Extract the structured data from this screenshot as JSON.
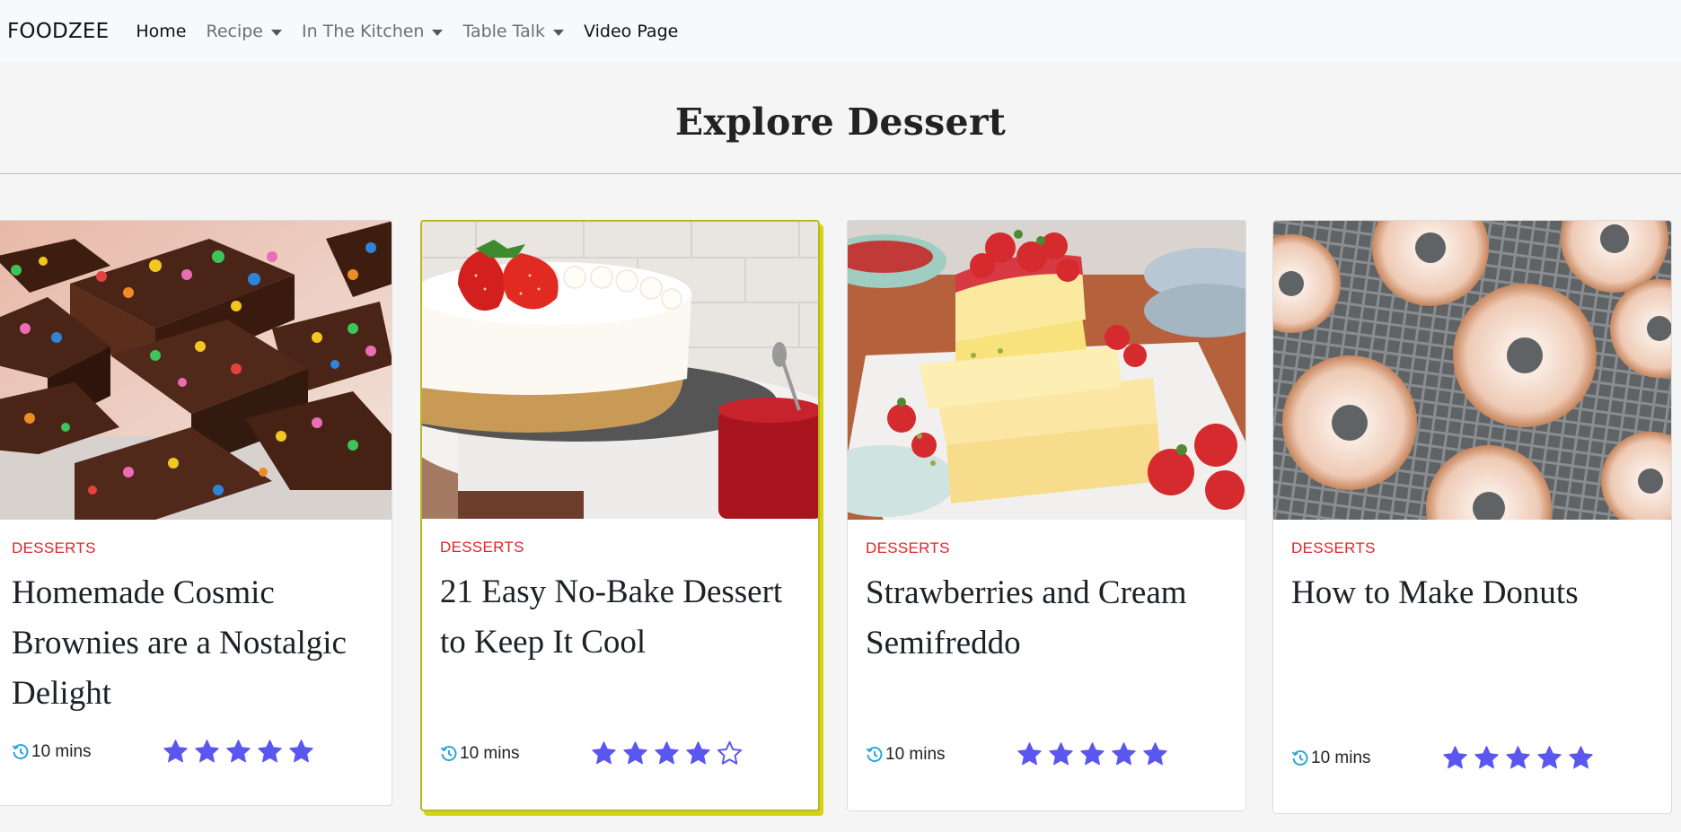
{
  "navbar": {
    "brand": "FOODZEE",
    "links": [
      {
        "label": "Home",
        "dropdown": false
      },
      {
        "label": "Recipe",
        "dropdown": true
      },
      {
        "label": "In The Kitchen",
        "dropdown": true
      },
      {
        "label": "Table Talk",
        "dropdown": true
      },
      {
        "label": "Video Page",
        "dropdown": false
      }
    ]
  },
  "page": {
    "title": "Explore Dessert"
  },
  "colors": {
    "category": "#e0262a",
    "star": "#5a56f0",
    "clock": "#2aa8d8",
    "highlight_border": "#d4d415"
  },
  "cards": [
    {
      "category": "DESSERTS",
      "title": "Homemade Cosmic Brownies are a Nostalgic Delight",
      "time": "10 mins",
      "rating": 5,
      "image": "brownies-photo"
    },
    {
      "category": "DESSERTS",
      "title": "21 Easy No-Bake Dessert to Keep It Cool",
      "time": "10 mins",
      "rating": 4,
      "image": "cheesecake-photo"
    },
    {
      "category": "DESSERTS",
      "title": "Strawberries and Cream Semifreddo",
      "time": "10 mins",
      "rating": 5,
      "image": "semifreddo-photo"
    },
    {
      "category": "DESSERTS",
      "title": "How to Make Donuts",
      "time": "10 mins",
      "rating": 5,
      "image": "donuts-photo"
    }
  ]
}
